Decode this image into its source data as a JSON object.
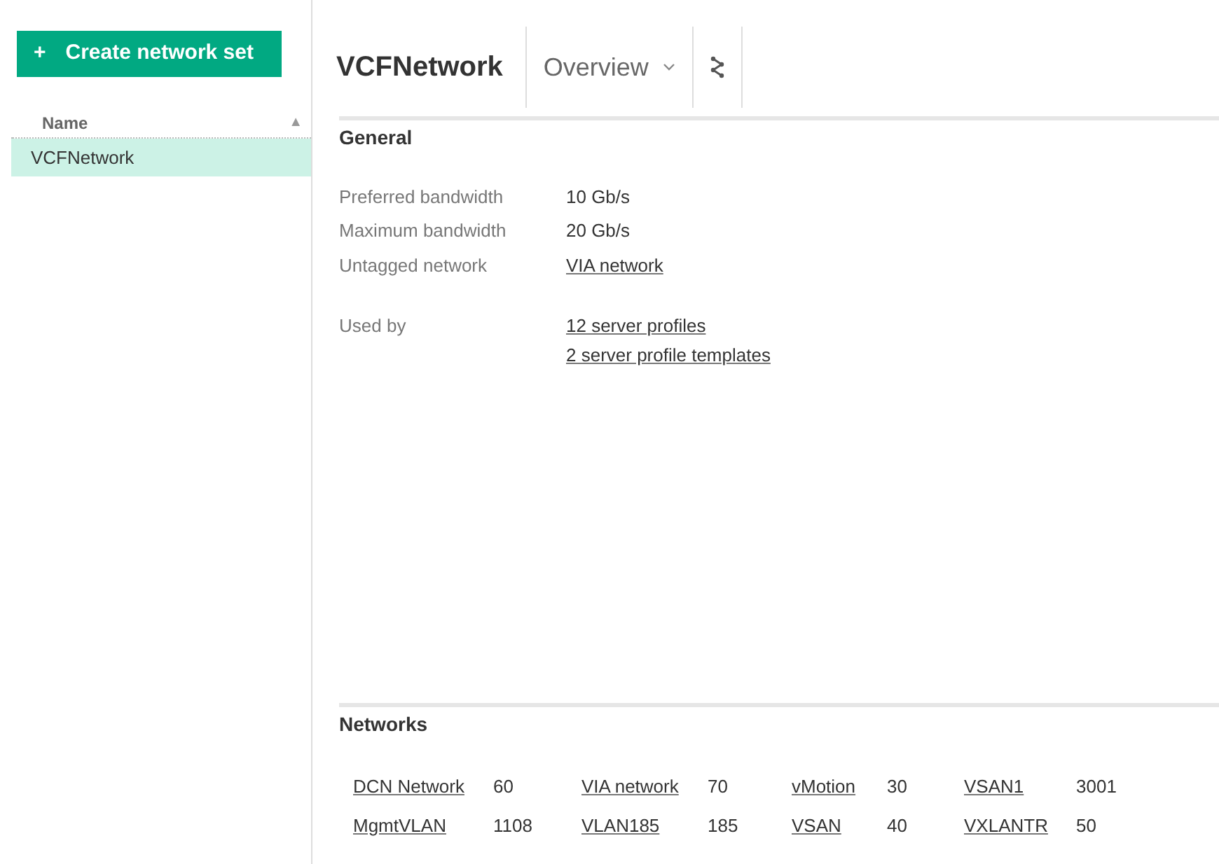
{
  "sidebar": {
    "create_button": {
      "icon": "+",
      "label": "Create network set"
    },
    "column": {
      "label": "Name",
      "sort": "▲"
    },
    "items": [
      {
        "label": "VCFNetwork",
        "selected": true
      }
    ]
  },
  "header": {
    "title": "VCFNetwork",
    "view_menu": {
      "label": "Overview"
    }
  },
  "general": {
    "title": "General",
    "fields": [
      {
        "label": "Preferred bandwidth",
        "values": [
          {
            "text": "10 Gb/s",
            "kind": "text"
          }
        ]
      },
      {
        "label": "Maximum bandwidth",
        "values": [
          {
            "text": "20 Gb/s",
            "kind": "text"
          }
        ]
      },
      {
        "label": "Untagged network",
        "values": [
          {
            "text": "VIA network",
            "kind": "link"
          }
        ]
      },
      {
        "label": "Used by",
        "values": [
          {
            "text": "12 server profiles",
            "kind": "link"
          },
          {
            "text": "2 server profile templates",
            "kind": "link"
          }
        ]
      }
    ]
  },
  "networks": {
    "title": "Networks",
    "items": [
      {
        "name": "DCN Network",
        "vlan": "60"
      },
      {
        "name": "VIA network",
        "vlan": "70"
      },
      {
        "name": "vMotion",
        "vlan": "30"
      },
      {
        "name": "VSAN1",
        "vlan": "3001"
      },
      {
        "name": "MgmtVLAN",
        "vlan": "1108"
      },
      {
        "name": "VLAN185",
        "vlan": "185"
      },
      {
        "name": "VSAN",
        "vlan": "40"
      },
      {
        "name": "VXLANTR",
        "vlan": "50"
      }
    ]
  }
}
